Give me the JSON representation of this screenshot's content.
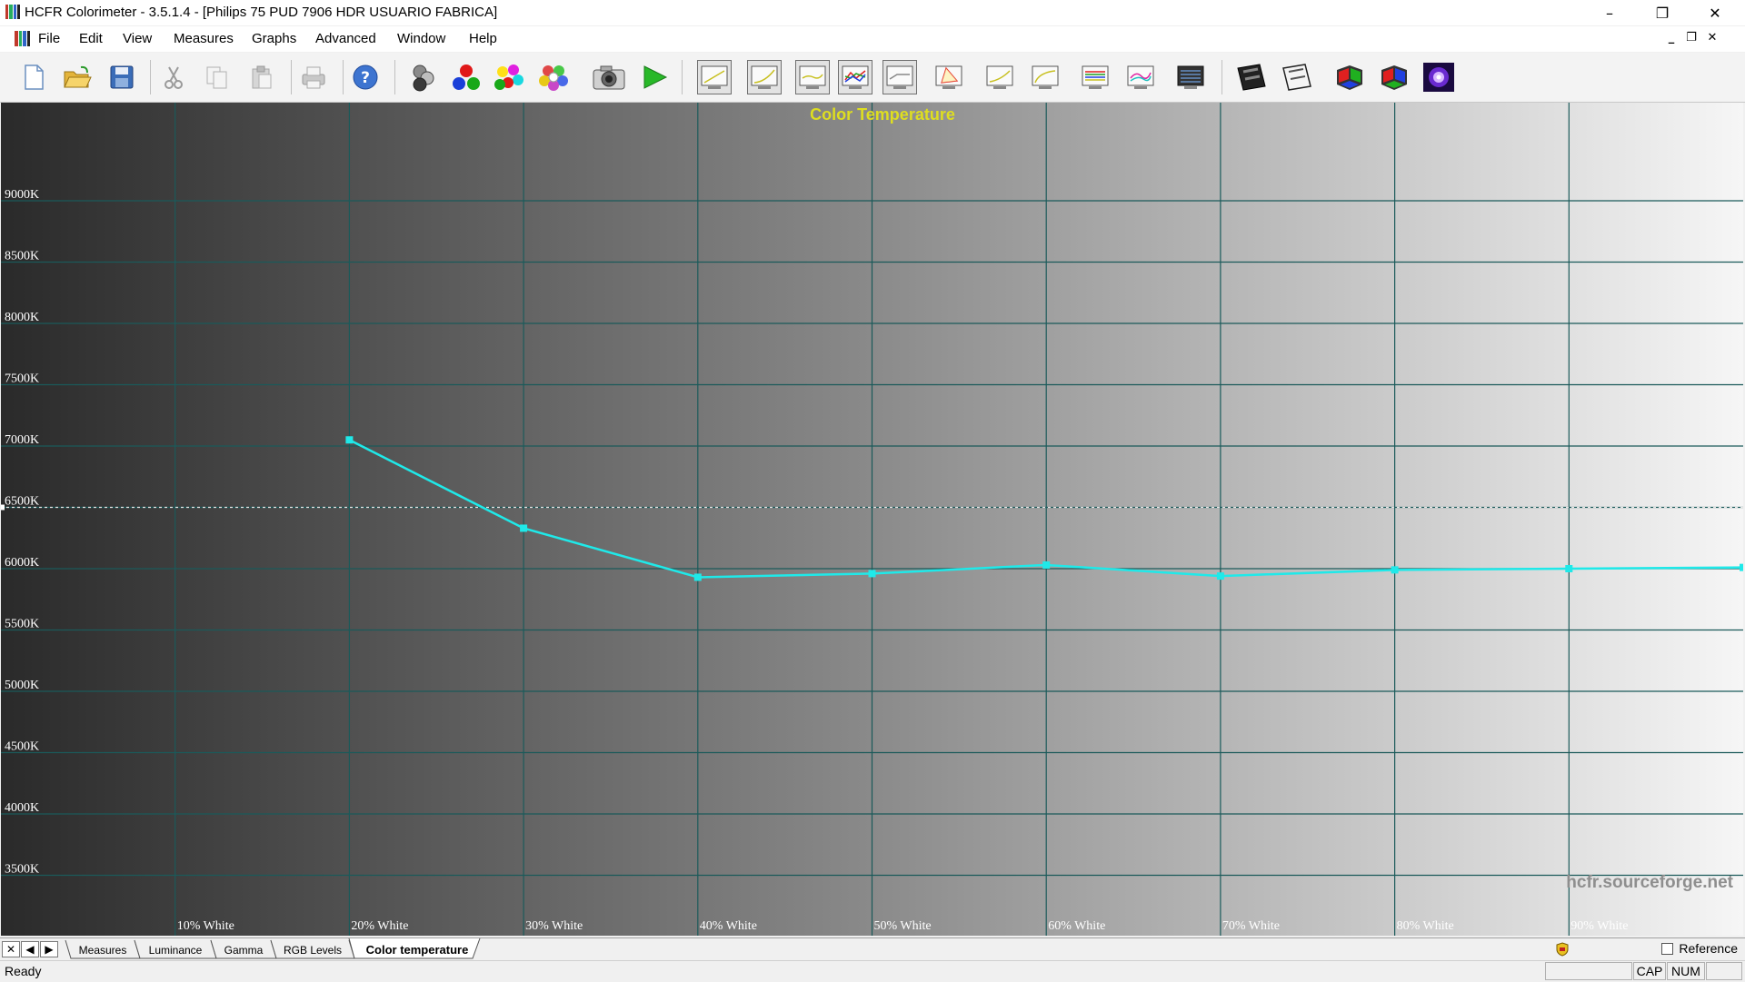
{
  "window": {
    "title": "HCFR Colorimeter - 3.5.1.4 - [Philips 75 PUD 7906 HDR USUARIO FABRICA]",
    "minimize_glyph": "–",
    "restore_glyph": "❐",
    "close_glyph": "✕"
  },
  "menu": {
    "items": [
      "File",
      "Edit",
      "View",
      "Measures",
      "Graphs",
      "Advanced",
      "Window",
      "Help"
    ],
    "mdi_minimize": "_",
    "mdi_restore": "❐",
    "mdi_close": "✕"
  },
  "toolbar": {
    "buttons": [
      {
        "name": "new-document-icon"
      },
      {
        "name": "open-folder-icon"
      },
      {
        "name": "save-disk-icon"
      },
      {
        "name": "cut-icon"
      },
      {
        "name": "copy-icon"
      },
      {
        "name": "paste-icon"
      },
      {
        "name": "print-icon"
      },
      {
        "name": "help-icon"
      },
      {
        "name": "measure-gray-icon"
      },
      {
        "name": "measure-primaries-icon"
      },
      {
        "name": "measure-secondaries-icon"
      },
      {
        "name": "measure-colors-icon"
      },
      {
        "name": "camera-icon"
      },
      {
        "name": "play-icon"
      },
      {
        "name": "graph-luminance-icon"
      },
      {
        "name": "graph-gamma-icon"
      },
      {
        "name": "graph-rgb-icon"
      },
      {
        "name": "graph-rgb-levels-icon"
      },
      {
        "name": "graph-color-temperature-icon"
      },
      {
        "name": "graph-cie-icon"
      },
      {
        "name": "graph-saturation-luminance-icon"
      },
      {
        "name": "graph-saturation-shift-icon"
      },
      {
        "name": "graph-near-black-icon"
      },
      {
        "name": "graph-near-white-icon"
      },
      {
        "name": "graph-measures-icon"
      },
      {
        "name": "film-strip-icon"
      },
      {
        "name": "film-strip-outline-icon"
      },
      {
        "name": "rgb-cube-icon"
      },
      {
        "name": "rgb-cube-alt-icon"
      },
      {
        "name": "sensor-light-icon"
      }
    ]
  },
  "chart_data": {
    "type": "line",
    "title": "Color Temperature",
    "watermark": "hcfr.sourceforge.net",
    "ylim": [
      3000,
      9800
    ],
    "yticks": [
      3500,
      4000,
      4500,
      5000,
      5500,
      6000,
      6500,
      7000,
      7500,
      8000,
      8500,
      9000
    ],
    "ytick_labels": [
      "3500K",
      "4000K",
      "4500K",
      "5000K",
      "5500K",
      "6000K",
      "6500K",
      "7000K",
      "7500K",
      "8000K",
      "8500K",
      "9000K"
    ],
    "xlim": [
      0,
      100
    ],
    "x_labels": [
      {
        "x": 10,
        "label": "10% White"
      },
      {
        "x": 20,
        "label": "20% White"
      },
      {
        "x": 30,
        "label": "30% White"
      },
      {
        "x": 40,
        "label": "40% White"
      },
      {
        "x": 50,
        "label": "50% White"
      },
      {
        "x": 60,
        "label": "60% White"
      },
      {
        "x": 70,
        "label": "70% White"
      },
      {
        "x": 80,
        "label": "80% White"
      },
      {
        "x": 90,
        "label": "90% White"
      }
    ],
    "grid": true,
    "reference_line": 6500,
    "series": [
      {
        "color": "#1fe9e9",
        "x": [
          20,
          30,
          40,
          50,
          60,
          70,
          80,
          90,
          100
        ],
        "y": [
          7050,
          6330,
          5930,
          5960,
          6030,
          5940,
          5990,
          6000,
          6010
        ]
      }
    ]
  },
  "tabs": {
    "items": [
      "Measures",
      "Luminance",
      "Gamma",
      "RGB Levels",
      "Color temperature"
    ],
    "active": "Color temperature",
    "nav_close": "✕",
    "nav_prev": "◀",
    "nav_next": "▶",
    "reference_label": "Reference"
  },
  "status": {
    "text": "Ready",
    "cap": "CAP",
    "num": "NUM"
  }
}
